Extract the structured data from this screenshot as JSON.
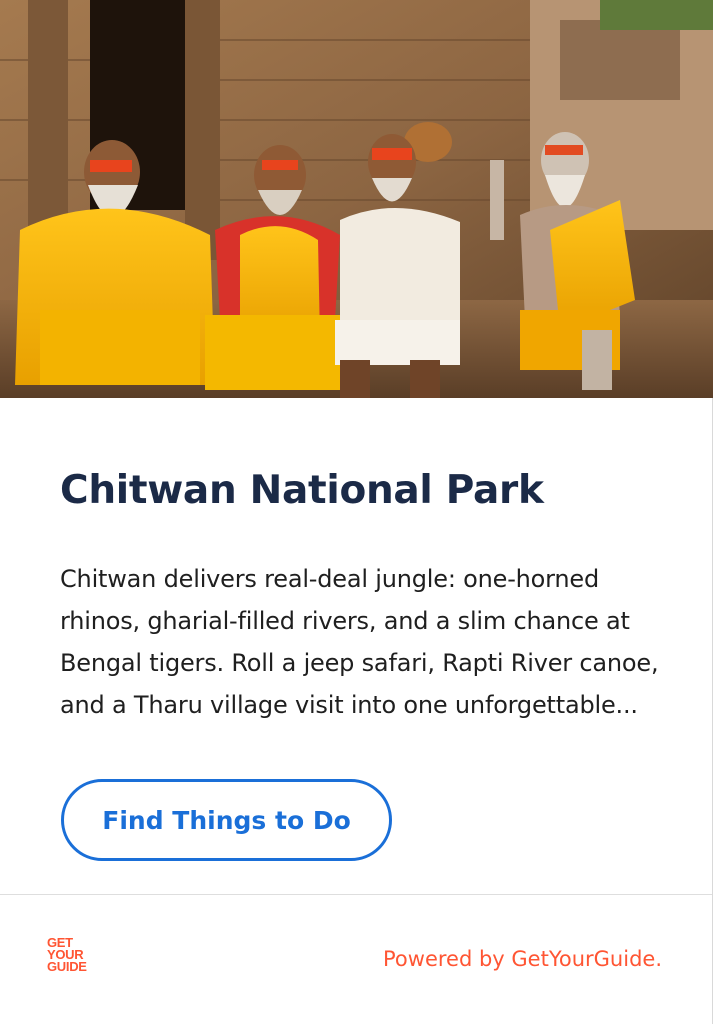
{
  "hero": {
    "image_alt": "Four sadhus in colorful robes seated in front of a stone temple"
  },
  "destination": {
    "title": "Chitwan National Park",
    "description": "Chitwan delivers real-deal jungle: one-horned rhinos, gharial-filled rivers, and a slim chance at Bengal tigers. Roll a jeep safari, Rapti River canoe, and a Tharu village visit into one unforgettable..."
  },
  "cta": {
    "label": "Find Things to Do"
  },
  "footer": {
    "logo_lines": [
      "GET",
      "YOUR",
      "GUIDE"
    ],
    "powered_by": "Powered by GetYourGuide."
  },
  "colors": {
    "title": "#1b2a47",
    "accent_blue": "#1a6fd8",
    "brand_orange": "#ff5533"
  }
}
